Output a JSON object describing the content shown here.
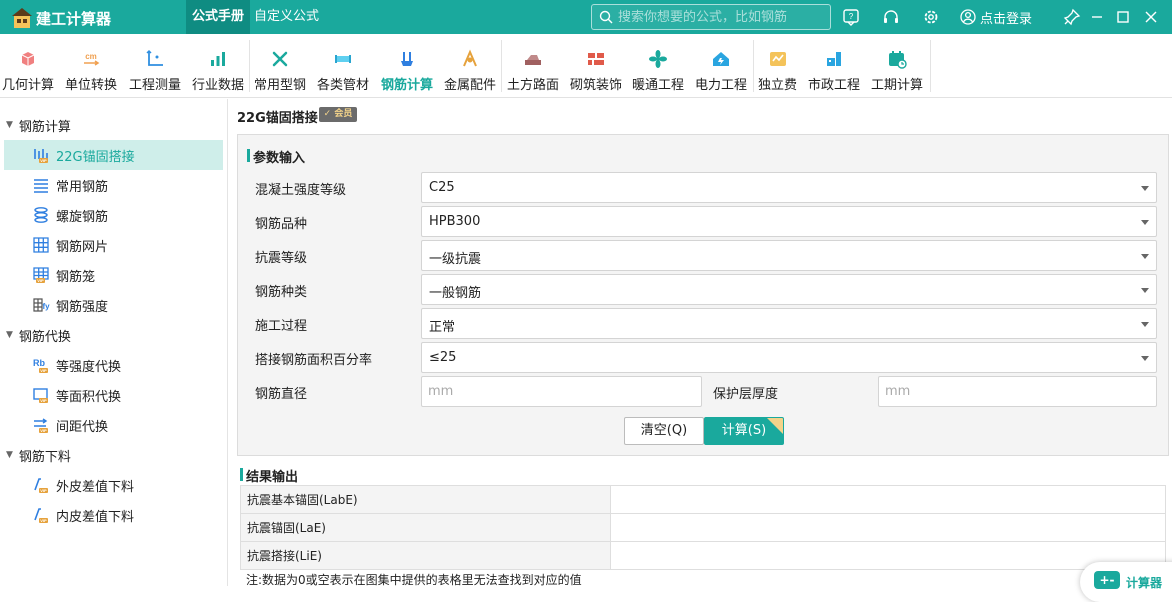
{
  "app": {
    "title": "建工计算器",
    "tabs": [
      {
        "label": "公式手册",
        "active": true
      },
      {
        "label": "自定义公式",
        "active": false
      }
    ],
    "search_placeholder": "搜索你想要的公式，比如钢筋",
    "login_label": "点击登录",
    "accent_color": "#1aa99d"
  },
  "toolbar": {
    "items": [
      {
        "label": "几何计算",
        "icon": "cube-icon"
      },
      {
        "label": "单位转换",
        "icon": "unit-convert-icon"
      },
      {
        "label": "工程测量",
        "icon": "measure-axis-icon"
      },
      {
        "label": "行业数据",
        "icon": "bar-chart-icon"
      },
      {
        "label": "常用型钢",
        "icon": "wrench-icon"
      },
      {
        "label": "各类管材",
        "icon": "pipe-icon"
      },
      {
        "label": "钢筋计算",
        "icon": "rebar-icon",
        "active": true
      },
      {
        "label": "金属配件",
        "icon": "metal-fitting-icon"
      },
      {
        "label": "土方路面",
        "icon": "road-icon"
      },
      {
        "label": "砌筑装饰",
        "icon": "brick-icon"
      },
      {
        "label": "暖通工程",
        "icon": "fan-icon"
      },
      {
        "label": "电力工程",
        "icon": "power-house-icon"
      },
      {
        "label": "独立费",
        "icon": "fee-icon"
      },
      {
        "label": "市政工程",
        "icon": "municipal-icon"
      },
      {
        "label": "工期计算",
        "icon": "calendar-icon"
      }
    ]
  },
  "sidebar": {
    "sections": [
      {
        "label": "钢筋计算",
        "items": [
          {
            "label": "22G锚固搭接",
            "icon": "anchor-bars-icon",
            "active": true
          },
          {
            "label": "常用钢筋",
            "icon": "lines-icon"
          },
          {
            "label": "螺旋钢筋",
            "icon": "spiral-icon"
          },
          {
            "label": "钢筋网片",
            "icon": "grid-icon"
          },
          {
            "label": "钢筋笼",
            "icon": "cage-icon"
          },
          {
            "label": "钢筋强度",
            "icon": "strength-icon"
          }
        ]
      },
      {
        "label": "钢筋代换",
        "items": [
          {
            "label": "等强度代换",
            "icon": "rb-icon"
          },
          {
            "label": "等面积代换",
            "icon": "area-icon"
          },
          {
            "label": "间距代换",
            "icon": "spacing-icon"
          }
        ]
      },
      {
        "label": "钢筋下料",
        "items": [
          {
            "label": "外皮差值下料",
            "icon": "bend-icon"
          },
          {
            "label": "内皮差值下料",
            "icon": "bend-icon"
          }
        ]
      }
    ]
  },
  "page": {
    "title": "22G锚固搭接",
    "badge": "会员",
    "input_section": "参数输入",
    "fields": [
      {
        "label": "混凝土强度等级",
        "value": "C25"
      },
      {
        "label": "钢筋品种",
        "value": "HPB300"
      },
      {
        "label": "抗震等级",
        "value": "一级抗震"
      },
      {
        "label": "钢筋种类",
        "value": "一般钢筋"
      },
      {
        "label": "施工过程",
        "value": "正常"
      },
      {
        "label": "搭接钢筋面积百分率",
        "value": "≤25"
      }
    ],
    "diameter_label": "钢筋直径",
    "diameter_placeholder": "mm",
    "cover_label": "保护层厚度",
    "cover_placeholder": "mm",
    "clear_button": "清空(Q)",
    "calc_button": "计算(S)",
    "output_section": "结果输出",
    "results": [
      {
        "label": "抗震基本锚固(LabE)",
        "value": ""
      },
      {
        "label": "抗震锚固(LaE)",
        "value": ""
      },
      {
        "label": "抗震搭接(LiE)",
        "value": ""
      }
    ],
    "note": "注:数据为0或空表示在图集中提供的表格里无法查找到对应的值",
    "float_button": "计算器",
    "float_icon": "+-"
  }
}
